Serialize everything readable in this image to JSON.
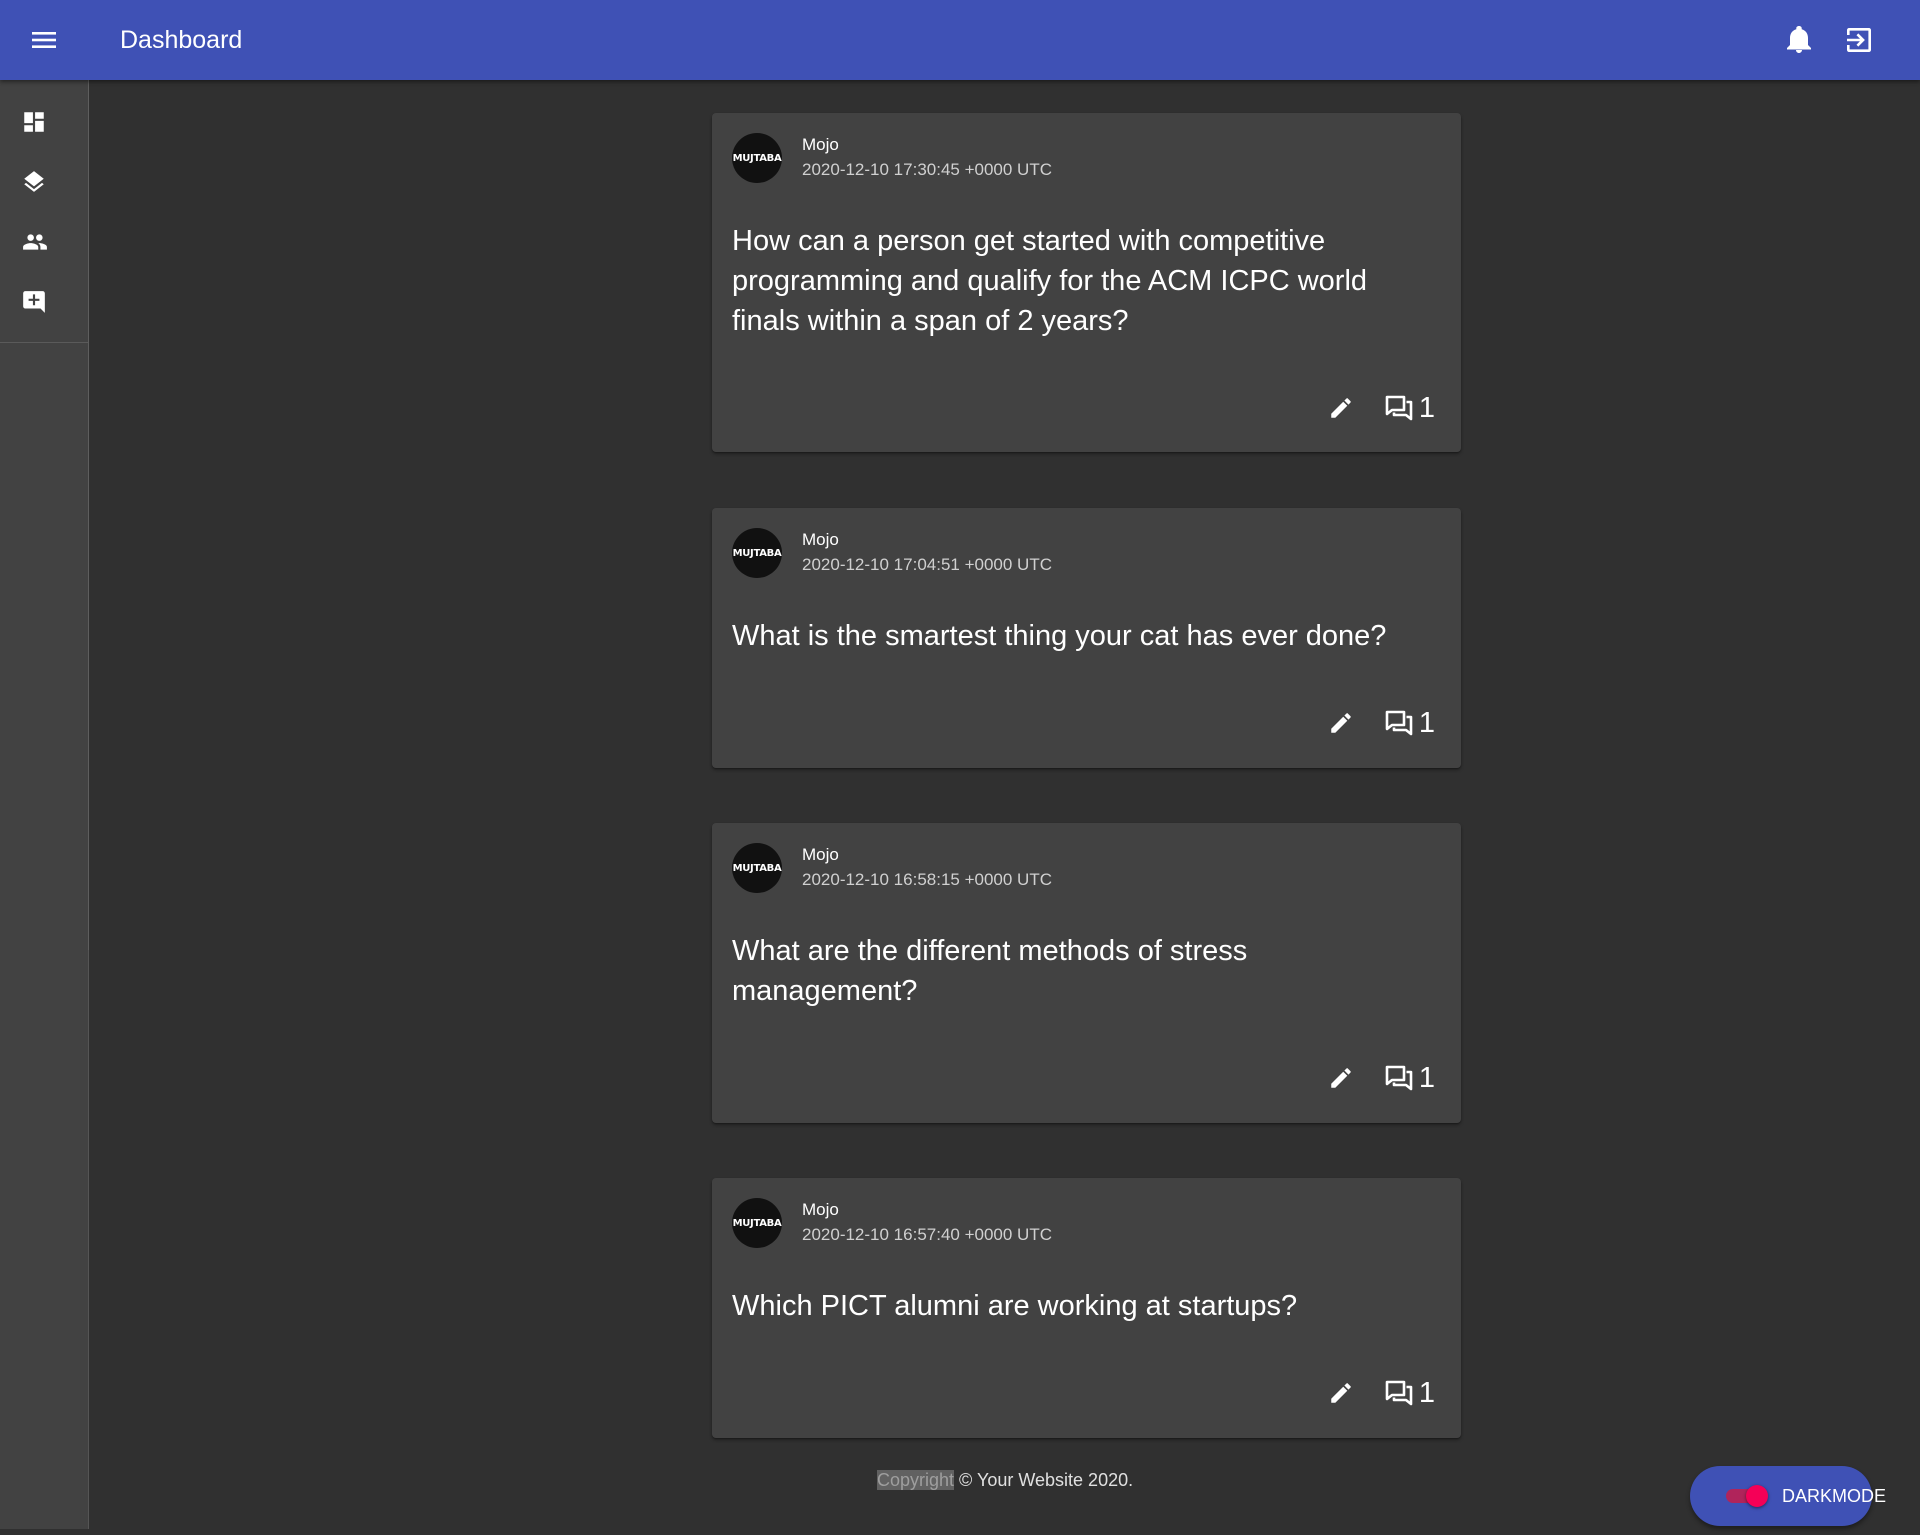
{
  "app_bar": {
    "title": "Dashboard",
    "color": "#3f51b5"
  },
  "sidebar": {
    "items": [
      {
        "icon": "dashboard-icon"
      },
      {
        "icon": "layers-icon"
      },
      {
        "icon": "people-icon"
      },
      {
        "icon": "add-comment-icon"
      }
    ]
  },
  "posts": [
    {
      "avatar_text": "MUJTABA",
      "author": "Mojo",
      "date": "2020-12-10 17:30:45 +0000 UTC",
      "question": "How can a person get started with competitive programming and qualify for the ACM ICPC world finals within a span of 2 years?",
      "comment_count": "1"
    },
    {
      "avatar_text": "MUJTABA",
      "author": "Mojo",
      "date": "2020-12-10 17:04:51 +0000 UTC",
      "question": "What is the smartest thing your cat has ever done?",
      "comment_count": "1"
    },
    {
      "avatar_text": "MUJTABA",
      "author": "Mojo",
      "date": "2020-12-10 16:58:15 +0000 UTC",
      "question": "What are the different methods of stress management?",
      "comment_count": "1"
    },
    {
      "avatar_text": "MUJTABA",
      "author": "Mojo",
      "date": "2020-12-10 16:57:40 +0000 UTC",
      "question": "Which PICT alumni are working at startups?",
      "comment_count": "1"
    }
  ],
  "footer": {
    "copyright_word": "Copyright",
    "rest": " © Your Website 2020."
  },
  "darkmode": {
    "label": "DARKMODE",
    "enabled": true,
    "accent": "#f50057"
  }
}
